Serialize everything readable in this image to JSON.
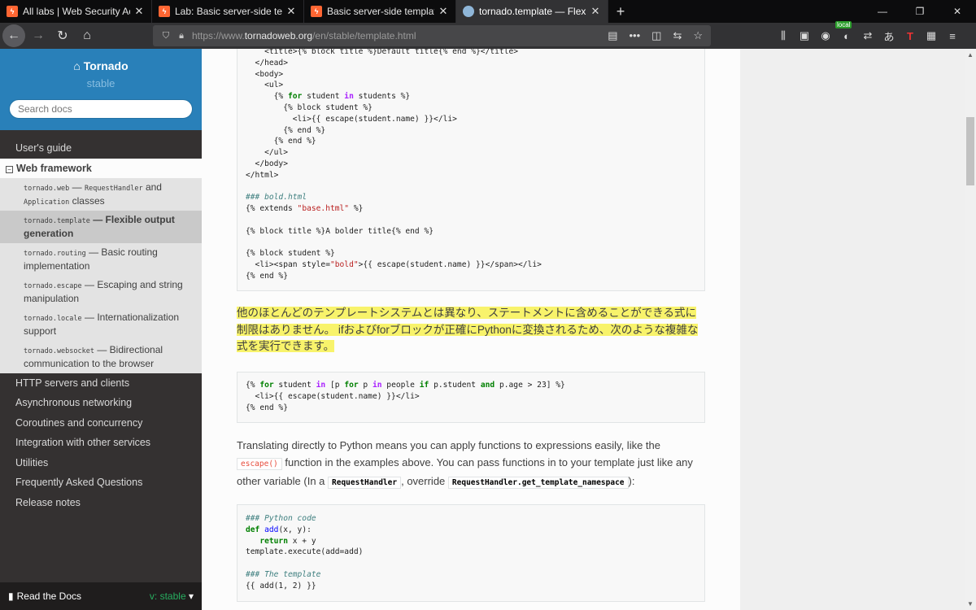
{
  "browser": {
    "tabs": [
      {
        "title": "All labs | Web Security Academy",
        "icon": "bolt"
      },
      {
        "title": "Lab: Basic server-side template injection",
        "icon": "bolt"
      },
      {
        "title": "Basic server-side template injection",
        "icon": "bolt"
      },
      {
        "title": "tornado.template — Flexible output generation",
        "icon": "globe"
      }
    ],
    "url_prefix": "https://www.",
    "url_domain": "tornadoweb.org",
    "url_path": "/en/stable/template.html",
    "local_badge": "local"
  },
  "sidebar": {
    "brand": "Tornado",
    "version": "stable",
    "search_placeholder": "Search docs",
    "items_top": [
      "User's guide"
    ],
    "section": "Web framework",
    "sub_items": [
      {
        "code": "tornado.web",
        "text": " — ",
        "code2": "RequestHandler",
        "mid": " and ",
        "code3": "Application",
        "tail": " classes"
      },
      {
        "code": "tornado.template",
        "text": " — Flexible output generation"
      },
      {
        "code": "tornado.routing",
        "text": " — Basic routing implementation"
      },
      {
        "code": "tornado.escape",
        "text": " — Escaping and string manipulation"
      },
      {
        "code": "tornado.locale",
        "text": " — Internationalization support"
      },
      {
        "code": "tornado.websocket",
        "text": " — Bidirectional communication to the browser"
      }
    ],
    "items_bottom": [
      "HTTP servers and clients",
      "Asynchronous networking",
      "Coroutines and concurrency",
      "Integration with other services",
      "Utilities",
      "Frequently Asked Questions",
      "Release notes"
    ],
    "footer_label": "Read the Docs",
    "footer_version": "v: stable"
  },
  "content": {
    "code1_lines": [
      "    <title>{% block title %}Default title{% end %}</title>",
      "  </head>",
      "  <body>",
      "    <ul>",
      "      {% for student in students %}",
      "        {% block student %}",
      "          <li>{{ escape(student.name) }}</li>",
      "        {% end %}",
      "      {% end %}",
      "    </ul>",
      "  </body>",
      "</html>",
      "",
      "### bold.html",
      "{% extends \"base.html\" %}",
      "",
      "{% block title %}A bolder title{% end %}",
      "",
      "{% block student %}",
      "  <li><span style=\"bold\">{{ escape(student.name) }}</span></li>",
      "{% end %}"
    ],
    "jp_text": "他のほとんどのテンプレートシステムとは異なり、ステートメントに含めることができる式に制限はありません。 ifおよびforブロックが正確にPythonに変換されるため、次のような複雑な式を実行できます。",
    "code2_lines": [
      "{% for student in [p for p in people if p.student and p.age > 23] %}",
      "  <li>{{ escape(student.name) }}</li>",
      "{% end %}"
    ],
    "en_part1": "Translating directly to Python means you can apply functions to expressions easily, like the ",
    "en_code1": "escape()",
    "en_part2": " function in the examples above. You can pass functions in to your template just like any other variable (In a ",
    "en_code2": "RequestHandler",
    "en_part3": ", override ",
    "en_code3": "RequestHandler.get_template_namespace",
    "en_part4": "):",
    "code3_lines": [
      "### Python code",
      "def add(x, y):",
      "   return x + y",
      "template.execute(add=add)",
      "",
      "### The template",
      "{{ add(1, 2) }}"
    ]
  }
}
